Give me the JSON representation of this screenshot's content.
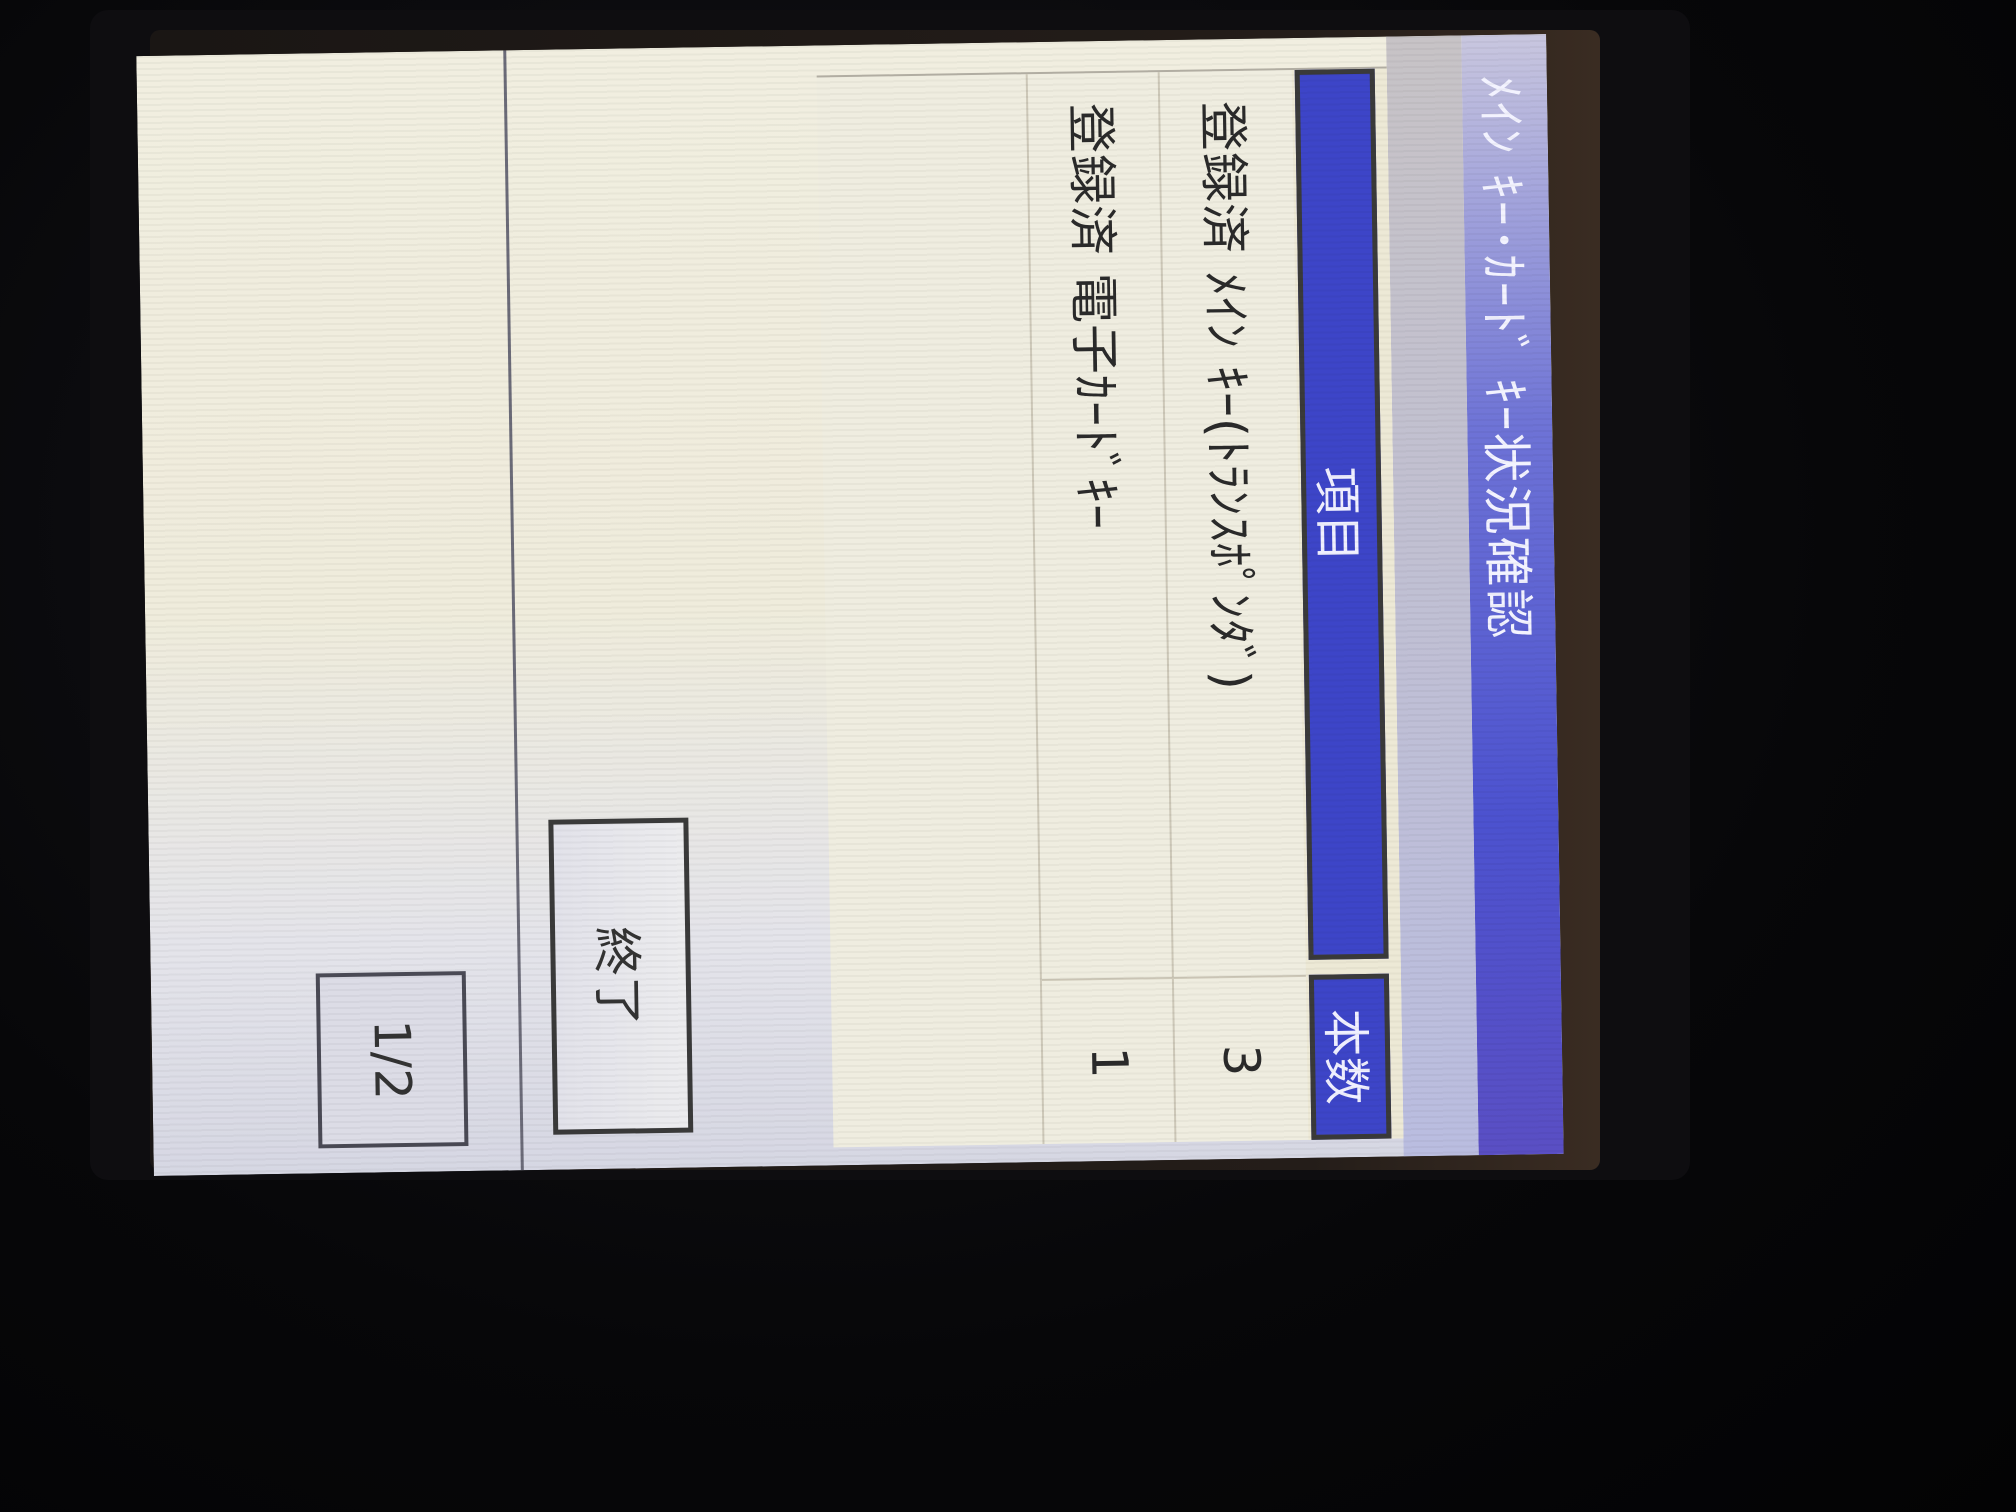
{
  "window": {
    "title": "ﾒｲﾝ ｷｰ･ｶｰﾄﾞ ｷｰ状況確認"
  },
  "table": {
    "header_item": "項目",
    "header_count": "本数",
    "rows": [
      {
        "label": "登録済 ﾒｲﾝ ｷｰ(ﾄﾗﾝｽﾎﾟﾝﾀﾞ)",
        "count": "3"
      },
      {
        "label": "登録済 電子ｶｰﾄﾞｷｰ",
        "count": "1"
      }
    ]
  },
  "buttons": {
    "done_label": "終了"
  },
  "pagination": {
    "indicator": "1/2"
  },
  "colors": {
    "title_bar": "#4c52cf",
    "header_cell": "#3d45c8",
    "screen_bg": "#efecdc"
  }
}
